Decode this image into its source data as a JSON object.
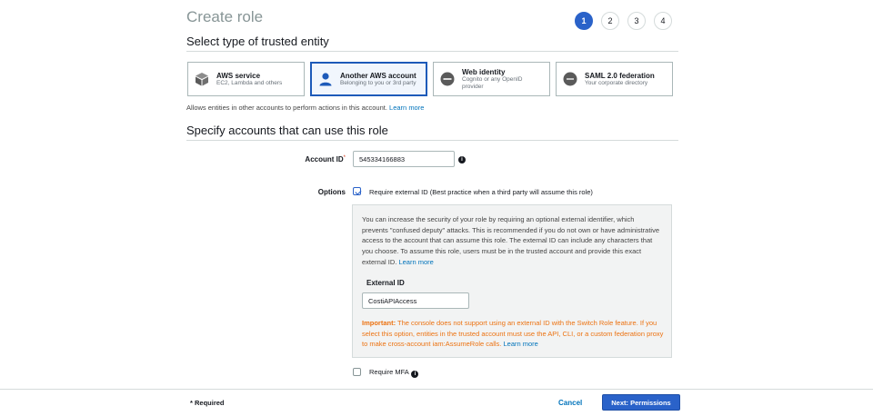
{
  "header": {
    "title": "Create role"
  },
  "steps": [
    "1",
    "2",
    "3",
    "4"
  ],
  "trusted_entity": {
    "heading": "Select type of trusted entity",
    "tiles": [
      {
        "label": "AWS service",
        "desc": "EC2, Lambda and others",
        "icon": "cube-icon",
        "selected": false
      },
      {
        "label": "Another AWS account",
        "desc": "Belonging to you or 3rd party",
        "icon": "user-icon",
        "selected": true
      },
      {
        "label": "Web identity",
        "desc": "Cognito or any OpenID provider",
        "icon": "openid-icon",
        "selected": false
      },
      {
        "label": "SAML 2.0 federation",
        "desc": "Your corporate directory",
        "icon": "saml-icon",
        "selected": false
      }
    ],
    "hint": "Allows entities in other accounts to perform actions in this account.",
    "hint_link": "Learn more"
  },
  "accounts": {
    "heading": "Specify accounts that can use this role",
    "account_id_label": "Account ID",
    "account_id_required": "*",
    "account_id_value": "545334166883",
    "options_label": "Options",
    "external_id_checkbox": "Require external ID (Best practice when a third party will assume this role)",
    "panel": {
      "description": "You can increase the security of your role by requiring an optional external identifier, which prevents \"confused deputy\" attacks. This is recommended if you do not own or have administrative access to the account that can assume this role. The external ID can include any characters that you choose. To assume this role, users must be in the trusted account and provide this exact external ID.",
      "description_link": "Learn more",
      "external_id_label": "External ID",
      "external_id_value": "CostiAPIAccess",
      "warning_prefix": "Important:",
      "warning_text": "The console does not support using an external ID with the Switch Role feature. If you select this option, entities in the trusted account must use the API, CLI, or a custom federation proxy to make cross-account iam:AssumeRole calls.",
      "warning_link": "Learn more"
    },
    "mfa_checkbox": "Require MFA"
  },
  "footer": {
    "required_note": "* Required",
    "cancel_label": "Cancel",
    "next_label": "Next: Permissions"
  },
  "colors": {
    "primary": "#2a62c9",
    "link": "#0073bb",
    "warning": "#ec7211"
  }
}
